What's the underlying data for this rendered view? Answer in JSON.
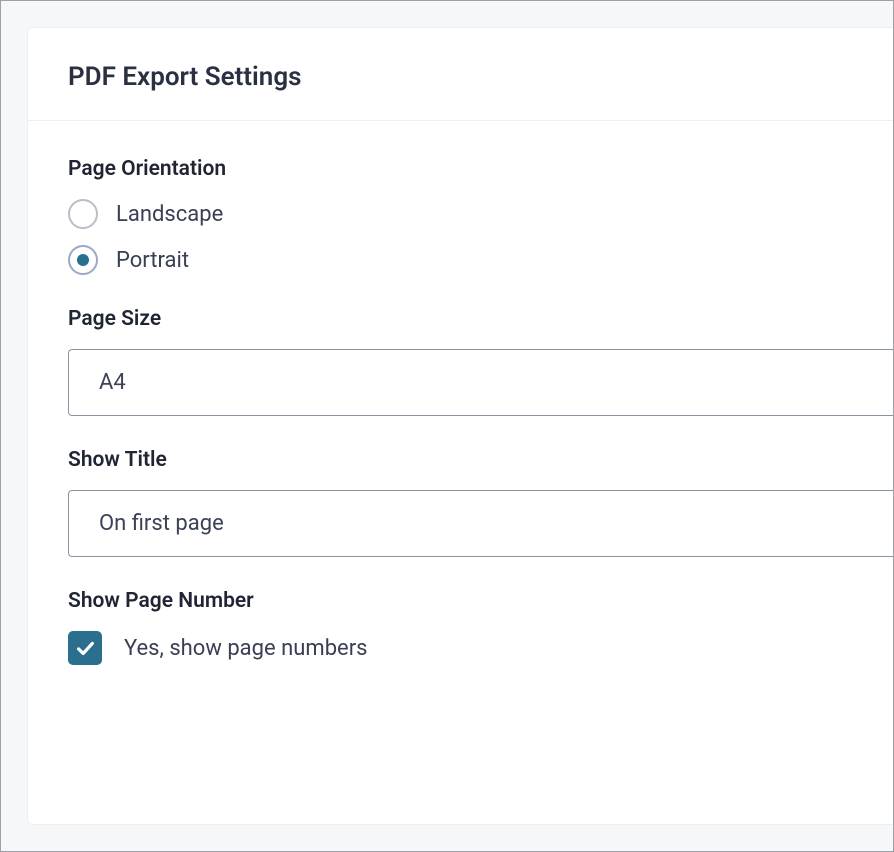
{
  "panel": {
    "title": "PDF Export Settings"
  },
  "orientation": {
    "label": "Page Orientation",
    "options": {
      "landscape": "Landscape",
      "portrait": "Portrait"
    },
    "selected": "portrait"
  },
  "pageSize": {
    "label": "Page Size",
    "value": "A4"
  },
  "showTitle": {
    "label": "Show Title",
    "value": "On first page"
  },
  "showPageNumber": {
    "label": "Show Page Number",
    "checkboxLabel": "Yes, show page numbers",
    "checked": true
  }
}
